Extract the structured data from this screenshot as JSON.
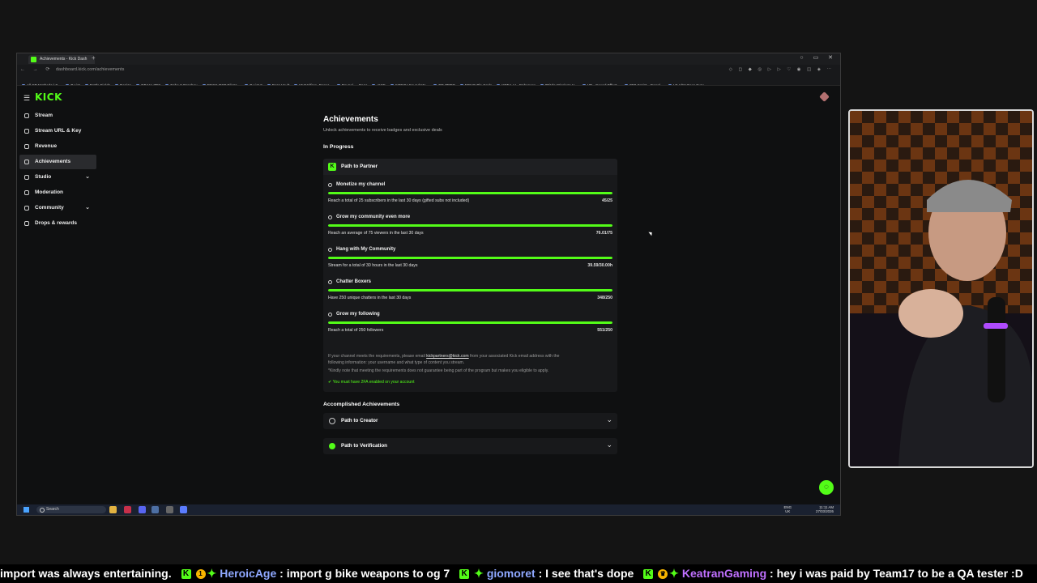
{
  "browser": {
    "tab_title": "Achievements - Kick Dash",
    "new_tab": "+",
    "url": "dashboard.kick.com/achievements",
    "bookmarks": [
      "All CB Methods | S...",
      "P List",
      "Battle Fields",
      "Resize",
      "OBJ to 3DS",
      "Echo-5 Dropbox",
      "FFXIK OST Eiko's...",
      "P List 2",
      "Pass Vault",
      "MyWelfare, Depar...",
      "Paypal → Banc",
      "AWS",
      "KOFXV Sound Mo...",
      "RE ZERO",
      "FF8 Battle Code",
      "KREA AI - Enhancer",
      "8Bitdo Wireless U...",
      "VB - Sound Effect...",
      "FF9 Script - Googl...",
      "LG UltraGear Curv..."
    ]
  },
  "sidebar": {
    "logo": "KICK",
    "items": [
      {
        "label": "Stream"
      },
      {
        "label": "Stream URL & Key"
      },
      {
        "label": "Revenue"
      },
      {
        "label": "Achievements"
      },
      {
        "label": "Studio"
      },
      {
        "label": "Moderation"
      },
      {
        "label": "Community"
      },
      {
        "label": "Drops & rewards"
      }
    ]
  },
  "main": {
    "title": "Achievements",
    "subtitle": "Unlock achievements to receive badges and exclusive deals",
    "in_progress_label": "In Progress",
    "card_title": "Path to Partner",
    "tasks": [
      {
        "name": "Monetize my channel",
        "desc": "Reach a total of 25 subscribers in the last 30 days (gifted subs not included)",
        "progress": "45/25",
        "fraction": 1.0
      },
      {
        "name": "Grow my community even more",
        "desc": "Reach an average of 75 viewers in the last 30 days",
        "progress": "76.01/75",
        "fraction": 1.0
      },
      {
        "name": "Hang with My Community",
        "desc": "Stream for a total of 30 hours in the last 30 days",
        "progress": "39.59/30.00h",
        "fraction": 1.0
      },
      {
        "name": "Chatter Boxers",
        "desc": "Have 250 unique chatters in the last 30 days",
        "progress": "348/250",
        "fraction": 1.0
      },
      {
        "name": "Grow my following",
        "desc": "Reach a total of 250 followers",
        "progress": "551/250",
        "fraction": 1.0
      }
    ],
    "note_line1_pre": "If your channel meets the requirements, please email ",
    "note_email": "kickpartners@kick.com",
    "note_line1_post": " from your associated Kick email address with the",
    "note_line2": "following information: your username and what type of content you stream.",
    "note_line3": "*Kindly note that meeting the requirements does not guarantee being part of the program but makes you eligible to apply.",
    "twofa": "You must have 2FA enabled on your account",
    "accomplished_label": "Accomplished Achievements",
    "accomplished": [
      {
        "title": "Path to Creator"
      },
      {
        "title": "Path to Verification"
      }
    ]
  },
  "taskbar": {
    "search": "Search",
    "lang1": "ENG",
    "lang2": "UK",
    "time": "11:11 AM",
    "date": "27/03/2026"
  },
  "ticker": {
    "msg0": "import was always entertaining.",
    "user1": "HeroicAge",
    "msg1": ": import g bike weapons to og 7",
    "user2": "giomoret",
    "msg2": ": I see that's dope",
    "user3": "KeatranGaming",
    "msg3": ": hey i was paid by Team17 to be a QA tester :D"
  },
  "colors": {
    "accent": "#53fc18",
    "background": "#0f1011",
    "card": "#18191b"
  }
}
